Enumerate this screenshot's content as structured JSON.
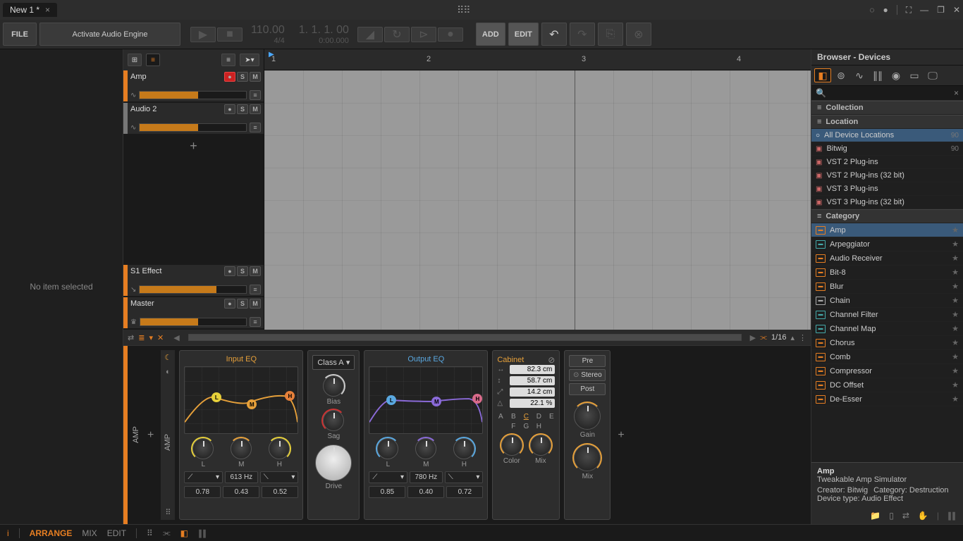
{
  "title_tab": "New 1 *",
  "toolbar": {
    "file": "FILE",
    "activate": "Activate Audio Engine",
    "tempo": "110.00",
    "sig": "4/4",
    "position": "1. 1. 1. 00",
    "time": "0:00.000",
    "add": "ADD",
    "edit": "EDIT"
  },
  "left_panel": {
    "empty": "No item selected"
  },
  "timeline": {
    "t1": "1",
    "t2": "2",
    "t3": "3",
    "t4": "4"
  },
  "tracks": [
    {
      "name": "Amp",
      "color": "#e67e22",
      "rec": true,
      "vol": 55
    },
    {
      "name": "Audio 2",
      "color": "#777",
      "rec": false,
      "vol": 55
    }
  ],
  "aux_tracks": [
    {
      "name": "S1 Effect",
      "color": "#e67e22",
      "vol": 72
    },
    {
      "name": "Master",
      "color": "#e67e22",
      "vol": 55
    }
  ],
  "arrange_footer": {
    "zoom": "1/16"
  },
  "device": {
    "chain_label": "AMP",
    "inner_label": "AMP",
    "input_eq": {
      "title": "Input EQ",
      "labels": {
        "l": "L",
        "m": "M",
        "h": "H"
      },
      "freq": "613 Hz",
      "vals": {
        "l": "0.78",
        "m": "0.43",
        "h": "0.52"
      }
    },
    "amp_class": "Class A",
    "bias": "Bias",
    "sag": "Sag",
    "drive": "Drive",
    "output_eq": {
      "title": "Output EQ",
      "labels": {
        "l": "L",
        "m": "M",
        "h": "H"
      },
      "freq": "780 Hz",
      "vals": {
        "l": "0.85",
        "m": "0.40",
        "h": "0.72"
      }
    },
    "cabinet": {
      "title": "Cabinet",
      "v1": "82.3 cm",
      "v2": "58.7 cm",
      "v3": "14.2 cm",
      "v4": "22.1 %",
      "letters": [
        "A",
        "B",
        "C",
        "D",
        "E",
        "F",
        "G",
        "H"
      ],
      "sel_letter": "C",
      "color": "Color",
      "mix": "Mix"
    },
    "prepost": {
      "pre": "Pre",
      "stereo": "Stereo",
      "post": "Post",
      "gain": "Gain",
      "mix": "Mix"
    }
  },
  "browser": {
    "title": "Browser - Devices",
    "search_ph": "",
    "collection": "Collection",
    "location": "Location",
    "locations": [
      {
        "name": "All Device Locations",
        "count": "90",
        "sel": true
      },
      {
        "name": "Bitwig",
        "count": "90"
      },
      {
        "name": "VST 2 Plug-ins"
      },
      {
        "name": "VST 2 Plug-ins (32 bit)"
      },
      {
        "name": "VST 3 Plug-ins"
      },
      {
        "name": "VST 3 Plug-ins (32 bit)"
      }
    ],
    "category": "Category",
    "categories": [
      {
        "name": "Amp",
        "sel": true,
        "k": "o"
      },
      {
        "name": "Arpeggiator",
        "k": "b"
      },
      {
        "name": "Audio Receiver",
        "k": "o"
      },
      {
        "name": "Bit-8",
        "k": "o"
      },
      {
        "name": "Blur",
        "k": "o"
      },
      {
        "name": "Chain",
        "k": "w"
      },
      {
        "name": "Channel Filter",
        "k": "b"
      },
      {
        "name": "Channel Map",
        "k": "b"
      },
      {
        "name": "Chorus",
        "k": "o"
      },
      {
        "name": "Comb",
        "k": "o"
      },
      {
        "name": "Compressor",
        "k": "o"
      },
      {
        "name": "DC Offset",
        "k": "o"
      },
      {
        "name": "De-Esser",
        "k": "o"
      }
    ],
    "info": {
      "name": "Amp",
      "desc": "Tweakable Amp Simulator",
      "l1a": "Creator: Bitwig",
      "l1b": "Category: Destruction",
      "l2": "Device type: Audio Effect"
    }
  },
  "status": {
    "arrange": "ARRANGE",
    "mix": "MIX",
    "edit": "EDIT"
  }
}
